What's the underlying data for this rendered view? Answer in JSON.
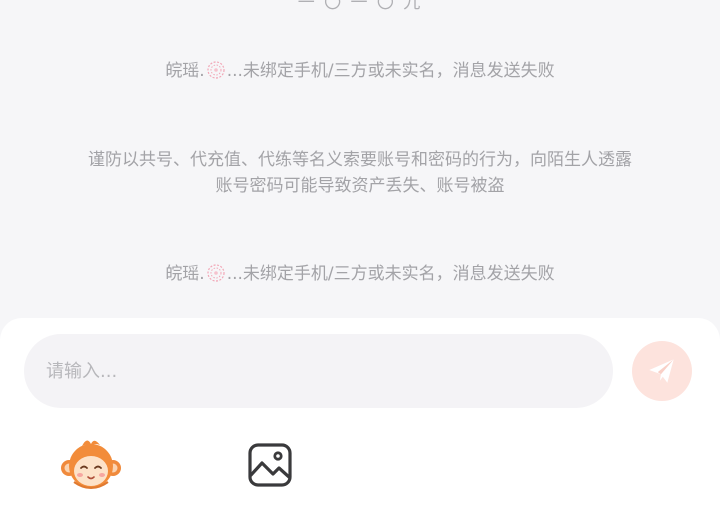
{
  "partial_top_text": "一 〇 一 〇 九",
  "messages": [
    {
      "text_before": "皖瑶.",
      "text_after": "...未绑定手机/三方或未实名，消息发送失败"
    },
    {
      "line1": "谨防以共号、代充值、代练等名义索要账号和密码的行为，向陌生人透露",
      "line2": "账号密码可能导致资产丢失、账号被盗"
    },
    {
      "text_before": "皖瑶.",
      "text_after": "...未绑定手机/三方或未实名，消息发送失败"
    }
  ],
  "composer": {
    "placeholder": "请输入...",
    "value": ""
  },
  "icons": {
    "flower": "flower-emoji-icon",
    "send": "paper-plane-icon",
    "mascot": "monkey-mascot-icon",
    "image": "image-gallery-icon"
  },
  "colors": {
    "background": "#f6f6f8",
    "system_text": "#a3a3a7",
    "send_button_bg": "#fde3dd",
    "send_icon": "#ffffff",
    "input_bg": "#f4f3f6"
  }
}
